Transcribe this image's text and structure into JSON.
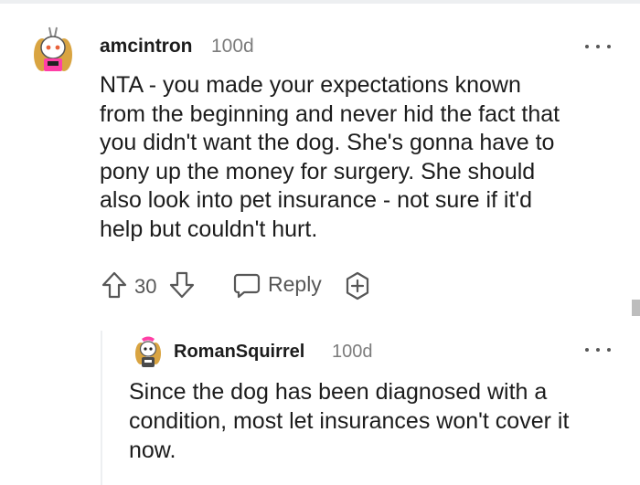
{
  "comments": [
    {
      "username": "amcintron",
      "age": "100d",
      "body": "NTA - you made your expectations known\nfrom the beginning and never hid the fact that\nyou didn't want the dog. She's gonna have to\npony up the money for surgery. She should\nalso look into pet insurance - not sure if it'd\nhelp but couldn't hurt.",
      "score": "30",
      "reply_label": "Reply"
    },
    {
      "username": "RomanSquirrel",
      "age": "100d",
      "body": "Since the dog has been diagnosed with a\ncondition, most let insurances won't cover it\nnow."
    }
  ],
  "icons": {
    "upvote": "arrow-up-icon",
    "downvote": "arrow-down-icon",
    "reply": "speech-bubble-icon",
    "award": "award-plus-icon",
    "more": "more-options-icon"
  },
  "colors": {
    "text": "#1c1c1c",
    "meta": "#7c7c7c",
    "icon": "#575757",
    "avatar_accent": "#ff3fa6"
  }
}
